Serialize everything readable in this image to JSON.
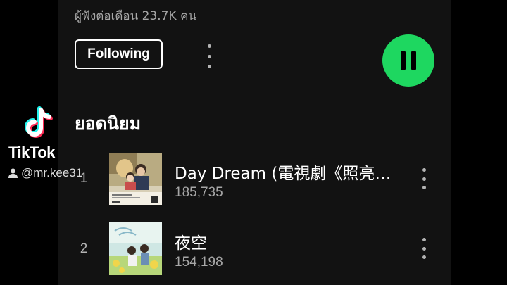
{
  "artist": {
    "monthly_listeners": "ผู้ฟังต่อเดือน 23.7K คน",
    "follow_label": "Following"
  },
  "colors": {
    "background": "#121212",
    "accent": "#1ed760",
    "secondary_text": "#a7a7a7"
  },
  "popular": {
    "title": "ยอดนิยม",
    "tracks": [
      {
        "number": "1",
        "title": "Day Dream (電視劇《照亮…",
        "plays": "185,735"
      },
      {
        "number": "2",
        "title": "夜空",
        "plays": "154,198"
      }
    ]
  },
  "watermark": {
    "brand": "TikTok",
    "username": "@mr.kee31"
  },
  "icons": [
    "more-options-icon",
    "pause-icon",
    "tiktok-logo-icon",
    "user-icon"
  ]
}
